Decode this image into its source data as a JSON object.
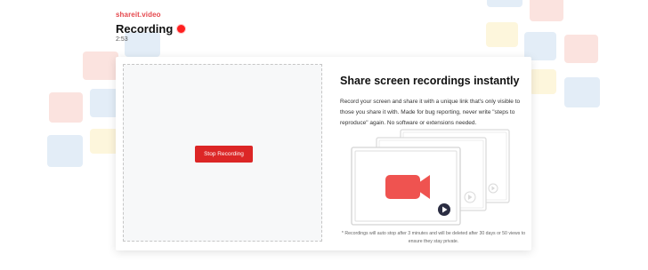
{
  "header": {
    "brand": "shareit.video",
    "title": "Recording",
    "timer": "2:53"
  },
  "recorder": {
    "stop_label": "Stop Recording"
  },
  "info": {
    "title": "Share screen recordings instantly",
    "description": "Record your screen and share it with a unique link that's only visible to those you share it with. Made for bug reporting, never write \"steps to reproduce\" again. No software or extensions needed.",
    "footnote": "* Recordings will auto stop after 3 minutes and will be deleted after 30 days or 50 views to ensure they stay private."
  },
  "colors": {
    "accent": "#dc2626",
    "record_dot": "#ff1f1f",
    "camera": "#ef5350",
    "tile_red": "#fbe3df",
    "tile_blue": "#e3edf7",
    "tile_yellow": "#fdf6dc"
  },
  "icons": {
    "record_indicator": "record-dot-icon",
    "camera": "video-camera-icon",
    "play": "play-icon"
  }
}
